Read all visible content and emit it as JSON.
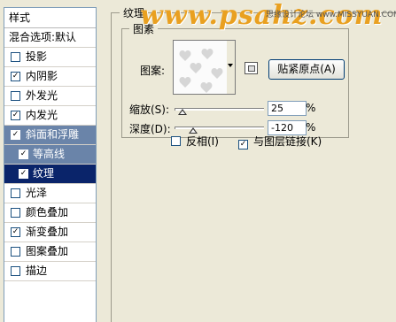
{
  "styles_panel": {
    "header": "样式",
    "blend_options": "混合选项:默认",
    "items": [
      {
        "label": "投影",
        "checked": false
      },
      {
        "label": "内阴影",
        "checked": true
      },
      {
        "label": "外发光",
        "checked": false
      },
      {
        "label": "内发光",
        "checked": true
      },
      {
        "label": "斜面和浮雕",
        "checked": true
      },
      {
        "label": "等高线",
        "checked": true
      },
      {
        "label": "纹理",
        "checked": true
      },
      {
        "label": "光泽",
        "checked": false
      },
      {
        "label": "颜色叠加",
        "checked": false
      },
      {
        "label": "渐变叠加",
        "checked": true
      },
      {
        "label": "图案叠加",
        "checked": false
      },
      {
        "label": "描边",
        "checked": false
      }
    ]
  },
  "texture": {
    "group_title": "纹理",
    "pattern_group_title": "图素",
    "pattern_label": "图案:",
    "snap_button": "贴紧原点(A)",
    "scale_label": "缩放(S):",
    "scale_value": "25",
    "scale_unit": "%",
    "depth_label": "深度(D):",
    "depth_value": "-120",
    "depth_unit": "%",
    "invert_label": "反相(I)",
    "invert_checked": false,
    "link_label": "与图层链接(K)",
    "link_checked": true
  },
  "watermark": {
    "text": "www.psahz.com",
    "caption": "思缘设计论坛  www.MISSYUAN.COM"
  },
  "icons": [
    "dropdown-arrow-icon",
    "new-preset-icon",
    "heart-pattern"
  ],
  "colors": {
    "selection": "#0a246a",
    "subheader": "#6a84a9",
    "panel_bg": "#ece9d8",
    "watermark": "#e9a020"
  }
}
